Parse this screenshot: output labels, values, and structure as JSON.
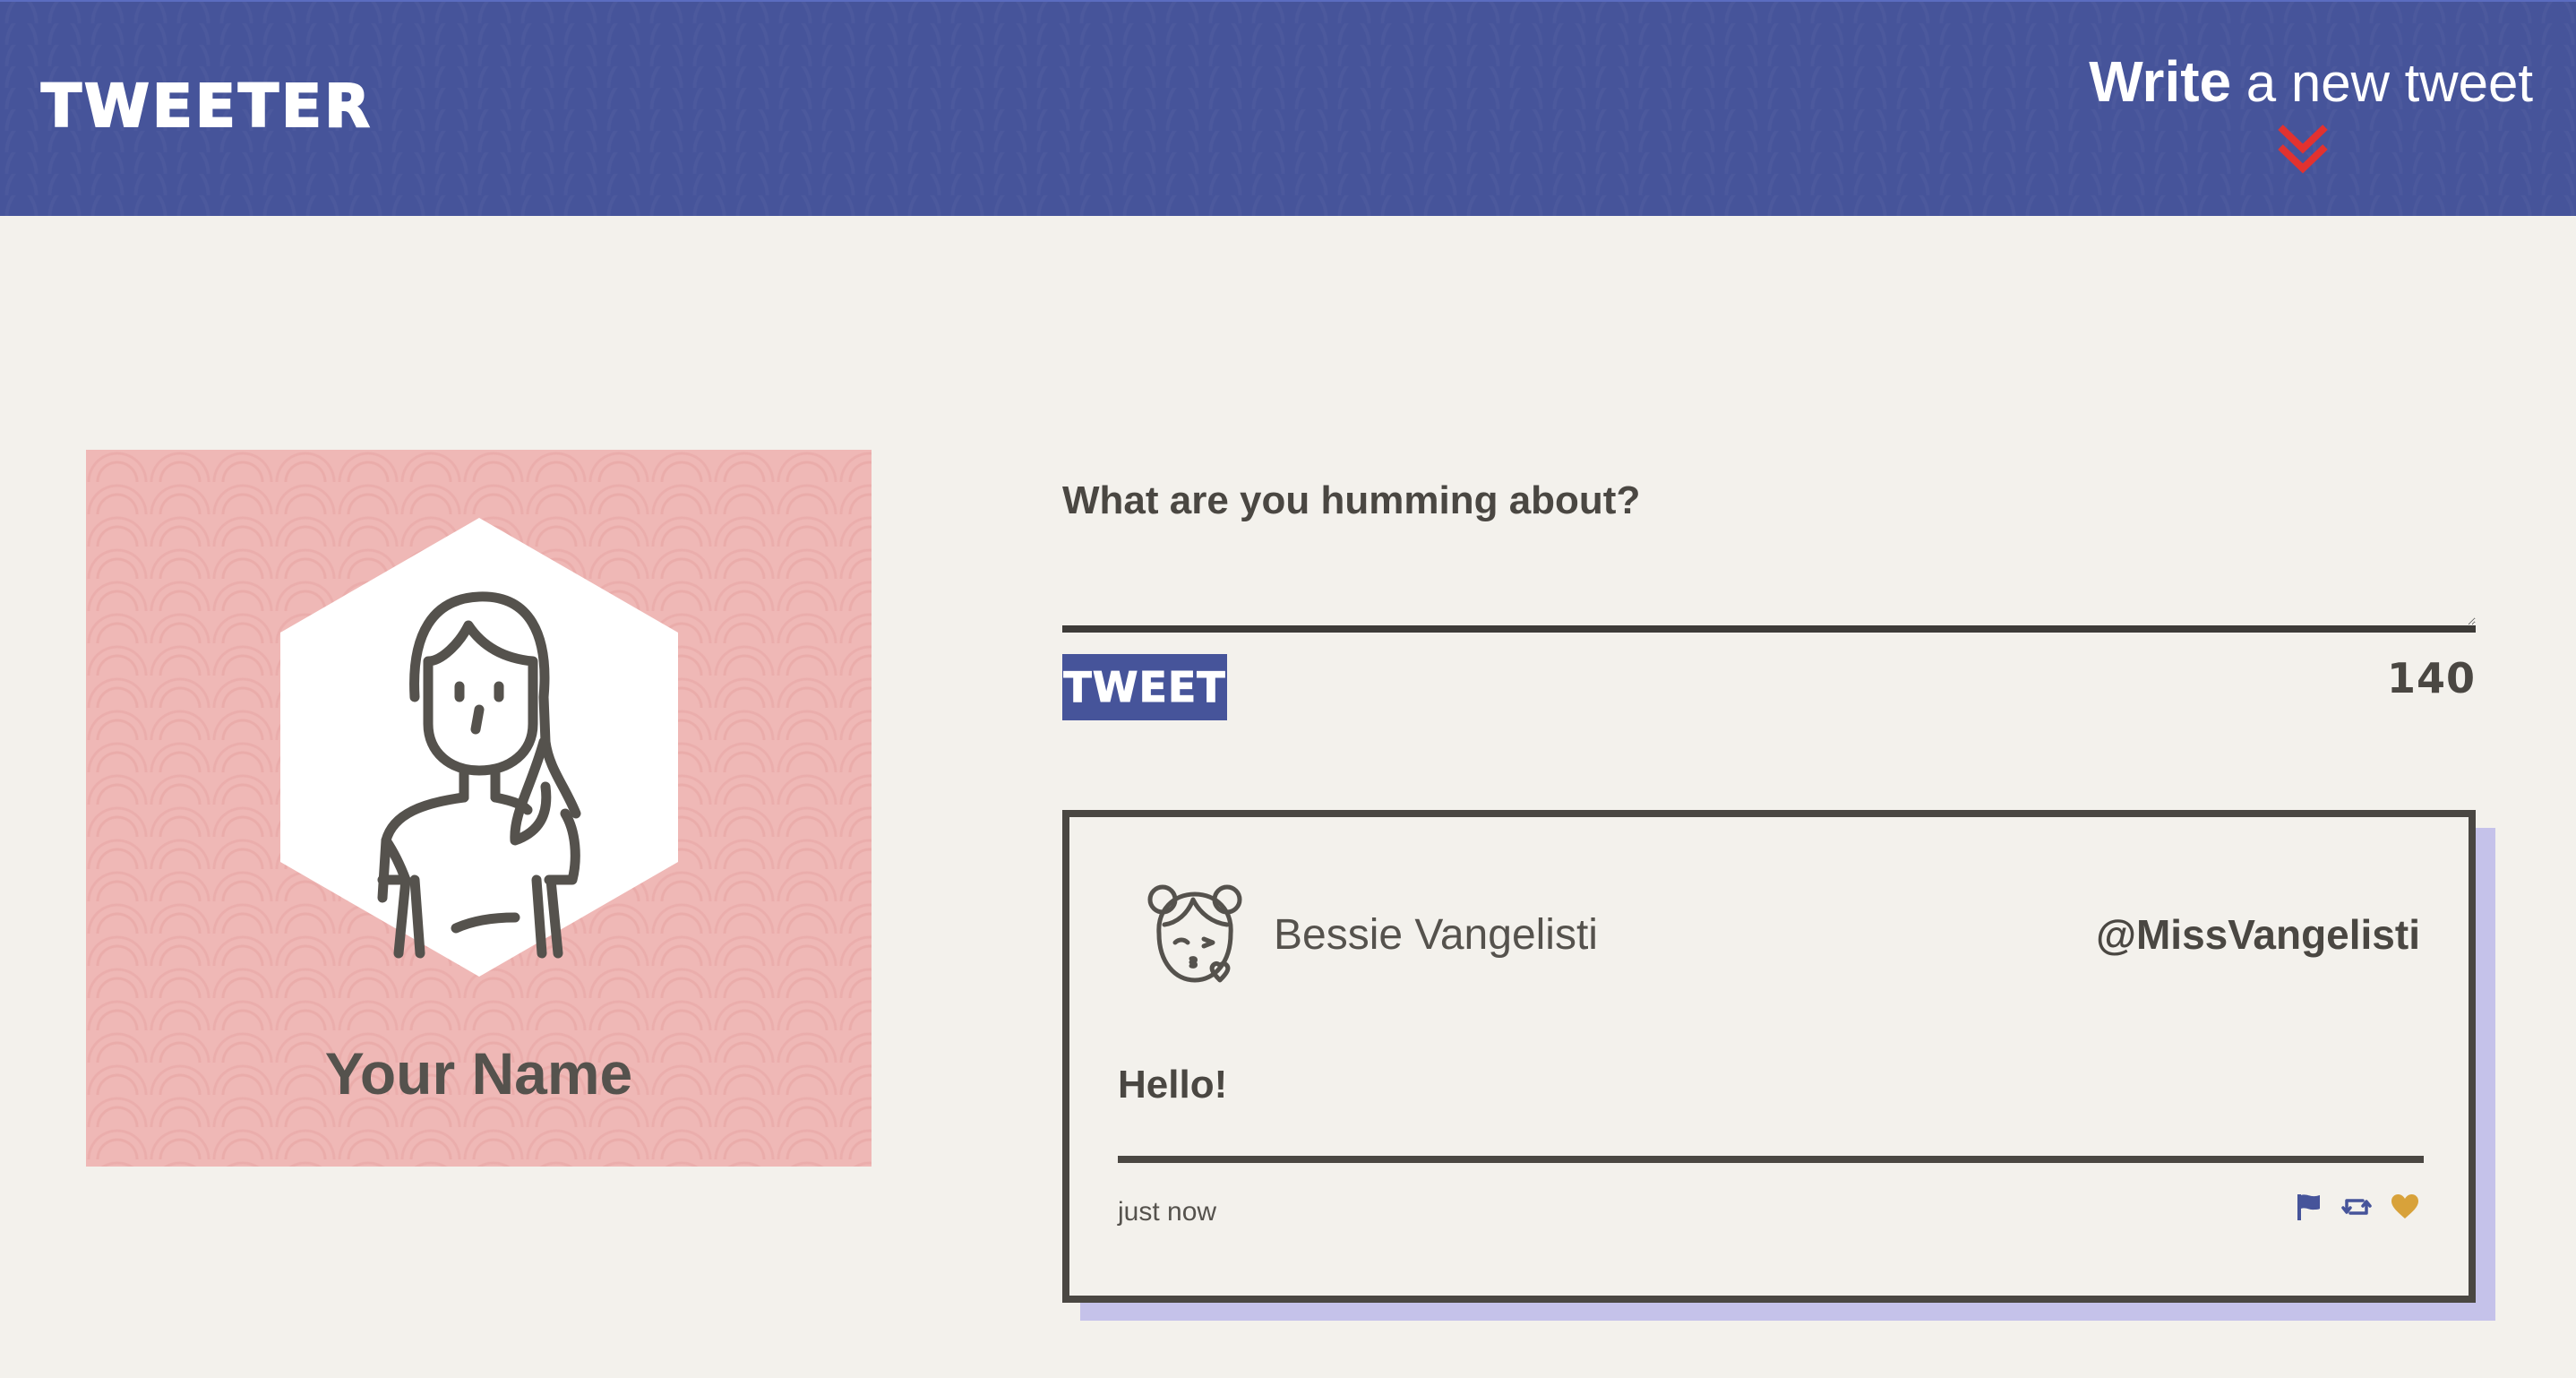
{
  "header": {
    "logo": "TWEETER",
    "compose_toggle": {
      "strong": "Write",
      "light": " a new tweet",
      "arrow_icon": "double-chevron-down-icon",
      "arrow_color": "#e2322f"
    },
    "background_color": "#46549a"
  },
  "profile": {
    "name": "Your Name",
    "avatar_icon": "woman-avatar-icon",
    "background_color": "#efb8b6"
  },
  "compose": {
    "prompt": "What are you humming about?",
    "input_value": "",
    "tweet_button": "TWEET",
    "char_counter": "140"
  },
  "tweets": [
    {
      "author_name": "Bessie Vangelisti",
      "author_handle": "@MissVangelisti",
      "avatar_icon": "girl-kiss-avatar-icon",
      "body": "Hello!",
      "timestamp": "just now",
      "actions": [
        {
          "icon": "flag-icon",
          "color": "#46549a"
        },
        {
          "icon": "retweet-icon",
          "color": "#46549a"
        },
        {
          "icon": "heart-icon",
          "color": "#d8a23a"
        }
      ]
    }
  ],
  "colors": {
    "page_background": "#f3f1ec",
    "text": "#4a4742",
    "accent": "#46549a",
    "card_shadow": "#c5c2ea"
  }
}
